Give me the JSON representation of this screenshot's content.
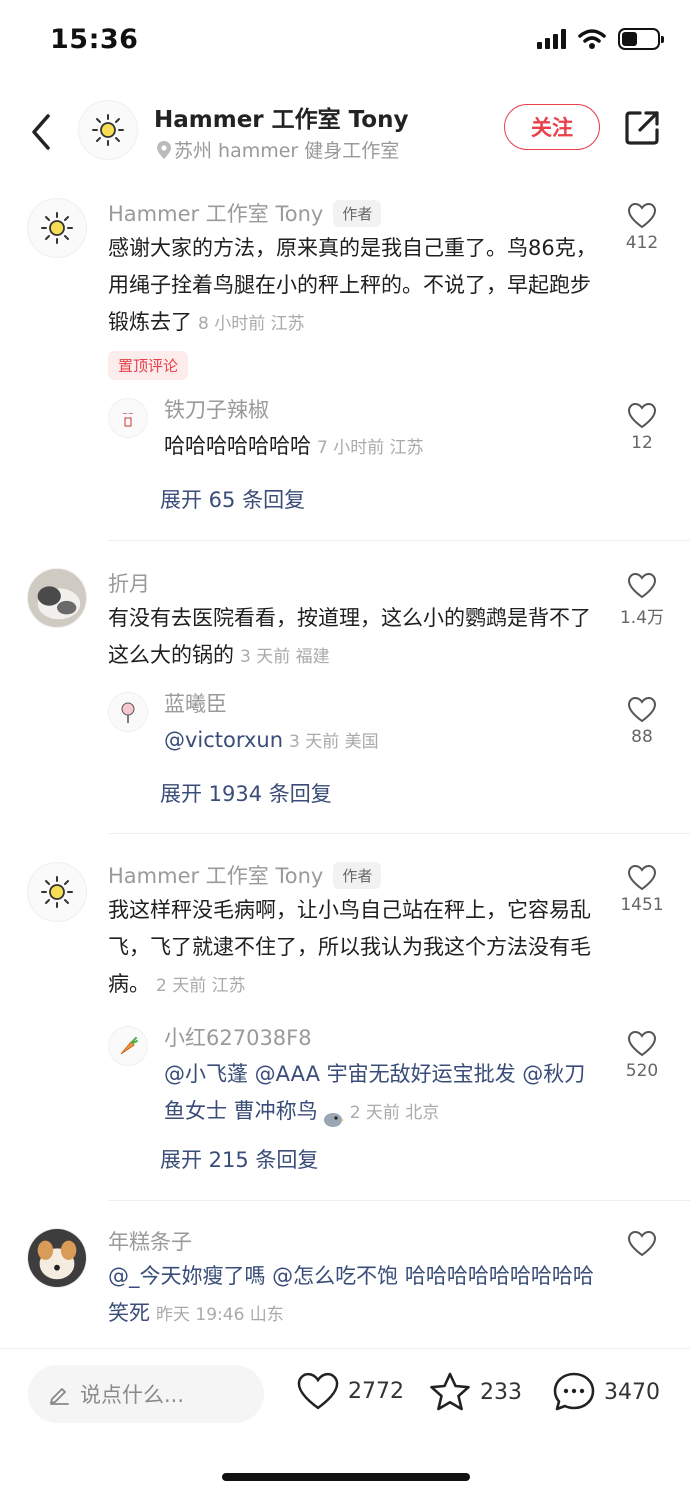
{
  "status": {
    "time": "15:36"
  },
  "header": {
    "name": "Hammer 工作室 Tony",
    "location": "苏州 hammer 健身工作室",
    "follow_label": "关注"
  },
  "comments": [
    {
      "name": "Hammer 工作室 Tony",
      "author_tag": "作者",
      "text": "感谢大家的方法，原来真的是我自己重了。鸟86克，用绳子拴着鸟腿在小的秤上秤的。不说了，早起跑步锻炼去了",
      "meta": "8 小时前 江苏",
      "pin": "置顶评论",
      "likes": "412",
      "reply": {
        "name": "铁刀子辣椒",
        "text": "哈哈哈哈哈哈哈",
        "meta": "7 小时前 江苏",
        "likes": "12"
      },
      "expand": "展开 65 条回复"
    },
    {
      "name": "折月",
      "text": "有没有去医院看看，按道理，这么小的鹦鹉是背不了这么大的锅的",
      "meta": "3 天前 福建",
      "likes": "1.4万",
      "reply": {
        "name": "蓝曦臣",
        "text": "@victorxun",
        "meta": "3 天前 美国",
        "likes": "88"
      },
      "expand": "展开 1934 条回复"
    },
    {
      "name": "Hammer 工作室 Tony",
      "author_tag": "作者",
      "text": "我这样秤没毛病啊，让小鸟自己站在秤上，它容易乱飞，飞了就逮不住了，所以我认为我这个方法没有毛病。",
      "meta": "2 天前 江苏",
      "likes": "1451",
      "reply": {
        "name": "小红627038F8",
        "text": "@小飞蓬 @AAA 宇宙无敌好运宝批发 @秋刀鱼女士 曹冲称鸟",
        "meta": "2 天前 北京",
        "likes": "520"
      },
      "expand": "展开 215 条回复"
    },
    {
      "name": "年糕条子",
      "text": "@_今天妳瘦了嗎 @怎么吃不饱 哈哈哈哈哈哈哈哈哈笑死",
      "meta": "昨天 19:46 山东",
      "likes": ""
    }
  ],
  "bottom": {
    "placeholder": "说点什么...",
    "likes": "2772",
    "stars": "233",
    "comments": "3470"
  },
  "colors": {
    "accent": "#e9404a",
    "link": "#3a4d78"
  },
  "icons": [
    "back-icon",
    "sun-icon",
    "location-icon",
    "share-icon",
    "heart-icon",
    "star-icon",
    "comment-icon",
    "pencil-icon"
  ]
}
